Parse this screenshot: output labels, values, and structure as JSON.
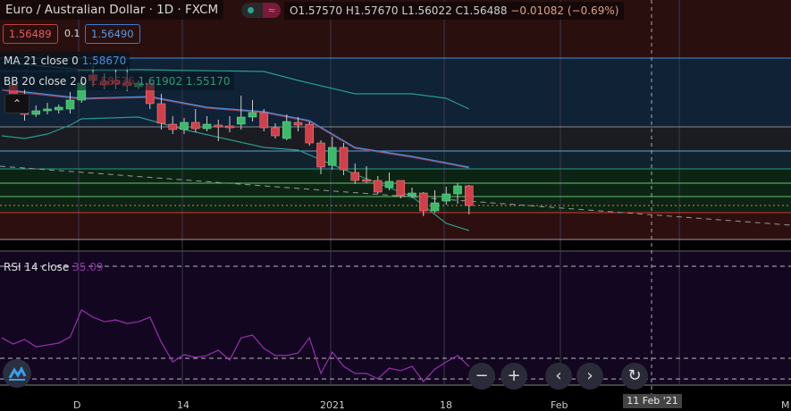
{
  "header": {
    "symbol": "Euro / Australian Dollar · 1D · FXCM",
    "status_icon": "market-open-dot",
    "open": "O1.57570",
    "high": "H1.57670",
    "low": "L1.56022",
    "close": "C1.56488",
    "change": "−0.01082 (−0.69%)"
  },
  "trade": {
    "sell": "1.56489",
    "spread": "0.1",
    "buy": "1.56490"
  },
  "indicators": {
    "ma_label": "MA 21 close 0",
    "ma_value": "1.58670",
    "bb_label": "BB 20 close 2 0",
    "bb_basis": "1.58536",
    "bb_upper": "1.61902",
    "bb_lower": "1.55170",
    "rsi_label": "RSI 14 close",
    "rsi_value": "35.09"
  },
  "time_axis": {
    "labels": [
      "D",
      "14",
      "2021",
      "18",
      "Feb",
      "M"
    ],
    "crosshair_date": "11 Feb '21"
  },
  "controls": {
    "zoom_out": "−",
    "zoom_in": "+",
    "scroll_left": "‹",
    "scroll_right": "›",
    "reset": "↻"
  },
  "colors": {
    "up": "#3cba6a",
    "down": "#d0404a",
    "ma": "#4a8ad8",
    "bb": "#2a9a8a",
    "rsi": "#9a30b0"
  },
  "chart_data": {
    "type": "candlestick",
    "candles": [
      [
        1.594,
        1.595,
        1.59,
        1.5906
      ],
      [
        1.591,
        1.593,
        1.586,
        1.5874
      ],
      [
        1.5874,
        1.5894,
        1.5868,
        1.5882
      ],
      [
        1.5882,
        1.59,
        1.5874,
        1.5886
      ],
      [
        1.5884,
        1.5896,
        1.5876,
        1.589
      ],
      [
        1.5886,
        1.5924,
        1.5876,
        1.5906
      ],
      [
        1.5906,
        1.596,
        1.59,
        1.5944
      ],
      [
        1.5962,
        1.5984,
        1.5936,
        1.595
      ],
      [
        1.5948,
        1.5966,
        1.593,
        1.594
      ],
      [
        1.595,
        1.5974,
        1.593,
        1.5942
      ],
      [
        1.5946,
        1.598,
        1.5926,
        1.5938
      ],
      [
        1.5936,
        1.595,
        1.593,
        1.5944
      ],
      [
        1.5944,
        1.595,
        1.5886,
        1.5898
      ],
      [
        1.5898,
        1.592,
        1.584,
        1.5854
      ],
      [
        1.5852,
        1.587,
        1.583,
        1.584
      ],
      [
        1.584,
        1.5866,
        1.583,
        1.5856
      ],
      [
        1.5856,
        1.5886,
        1.5834,
        1.5842
      ],
      [
        1.5842,
        1.587,
        1.5836,
        1.5852
      ],
      [
        1.585,
        1.5862,
        1.5814,
        1.5846
      ],
      [
        1.5848,
        1.587,
        1.5834,
        1.5844
      ],
      [
        1.5852,
        1.5916,
        1.584,
        1.5868
      ],
      [
        1.5868,
        1.5906,
        1.5858,
        1.5878
      ],
      [
        1.5878,
        1.5886,
        1.5836,
        1.5844
      ],
      [
        1.5844,
        1.5854,
        1.582,
        1.5826
      ],
      [
        1.582,
        1.5874,
        1.5816,
        1.5858
      ],
      [
        1.5856,
        1.5868,
        1.5836,
        1.585
      ],
      [
        1.5852,
        1.5858,
        1.5804,
        1.581
      ],
      [
        1.581,
        1.5816,
        1.574,
        1.5756
      ],
      [
        1.576,
        1.5824,
        1.575,
        1.58
      ],
      [
        1.58,
        1.581,
        1.5738,
        1.575
      ],
      [
        1.5744,
        1.5764,
        1.5718,
        1.5726
      ],
      [
        1.5728,
        1.5758,
        1.572,
        1.5724
      ],
      [
        1.5726,
        1.5736,
        1.5696,
        1.57
      ],
      [
        1.571,
        1.5744,
        1.5704,
        1.5724
      ],
      [
        1.5726,
        1.5726,
        1.5686,
        1.5692
      ],
      [
        1.5692,
        1.571,
        1.5686,
        1.5698
      ],
      [
        1.5698,
        1.57,
        1.5646,
        1.5658
      ],
      [
        1.5658,
        1.5704,
        1.5654,
        1.5676
      ],
      [
        1.568,
        1.5712,
        1.5672,
        1.5696
      ],
      [
        1.5696,
        1.572,
        1.5674,
        1.5714
      ],
      [
        1.5714,
        1.5716,
        1.565,
        1.567
      ]
    ],
    "first_candle_index": 1,
    "ma": [
      [
        0,
        1.593
      ],
      [
        7,
        1.591
      ],
      [
        13,
        1.5914
      ],
      [
        18,
        1.589
      ],
      [
        23,
        1.588
      ],
      [
        27,
        1.586
      ],
      [
        31,
        1.58
      ],
      [
        36,
        1.578
      ],
      [
        41,
        1.5756
      ]
    ],
    "bb_upper": [
      [
        0,
        1.599
      ],
      [
        7,
        1.5974
      ],
      [
        12,
        1.5974
      ],
      [
        23,
        1.597
      ],
      [
        26,
        1.595
      ],
      [
        31,
        1.592
      ],
      [
        36,
        1.592
      ],
      [
        39,
        1.591
      ],
      [
        41,
        1.5886
      ]
    ],
    "bb_lower": [
      [
        0,
        1.5826
      ],
      [
        2,
        1.582
      ],
      [
        4,
        1.583
      ],
      [
        6,
        1.585
      ],
      [
        7,
        1.5864
      ],
      [
        12,
        1.5868
      ],
      [
        16,
        1.584
      ],
      [
        23,
        1.58
      ],
      [
        26,
        1.5794
      ],
      [
        31,
        1.574
      ],
      [
        36,
        1.569
      ],
      [
        39,
        1.563
      ],
      [
        41,
        1.5614
      ]
    ],
    "levels": [
      1.6,
      1.5846,
      1.5792,
      1.5752,
      1.572,
      1.569,
      1.567,
      1.5654,
      1.5594
    ],
    "rsi": [
      38.9,
      36.2,
      38.2,
      35.0,
      35.8,
      36.6,
      39.3,
      51.0,
      47.9,
      45.9,
      46.7,
      45.1,
      45.9,
      47.9,
      37.0,
      28.4,
      31.6,
      30.4,
      31.2,
      33.5,
      29.2,
      38.9,
      40.1,
      34.3,
      31.2,
      31.2,
      32.3,
      38.9,
      23.4,
      32.7,
      26.5,
      23.4,
      23.4,
      21.1,
      25.7,
      24.6,
      26.5,
      19.9,
      25.3,
      28.4,
      31.2,
      26.5
    ],
    "rsi_bands": [
      70,
      30,
      21
    ]
  }
}
